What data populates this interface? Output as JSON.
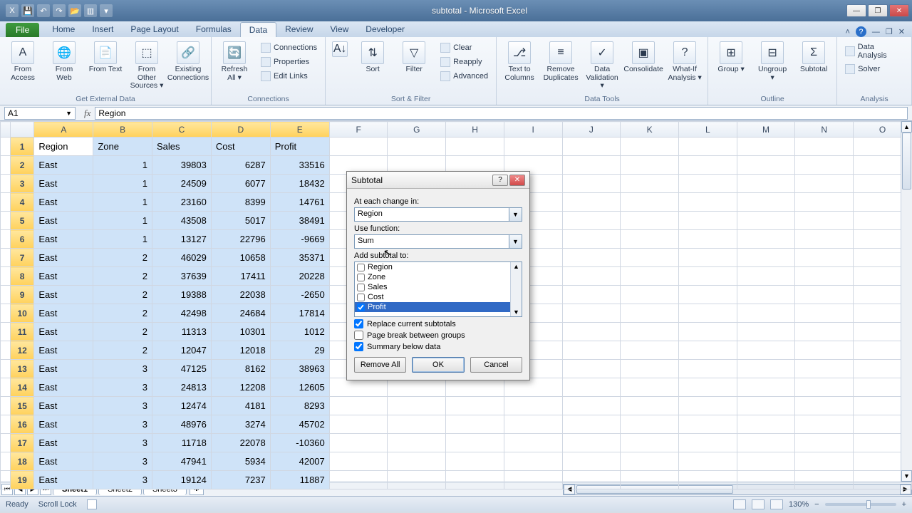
{
  "window": {
    "title": "subtotal - Microsoft Excel"
  },
  "tabs": {
    "file": "File",
    "list": [
      "Home",
      "Insert",
      "Page Layout",
      "Formulas",
      "Data",
      "Review",
      "View",
      "Developer"
    ],
    "active": "Data"
  },
  "ribbon": {
    "external": {
      "label": "Get External Data",
      "btns": [
        {
          "lbl": "From Access",
          "ico": "A"
        },
        {
          "lbl": "From Web",
          "ico": "🌐"
        },
        {
          "lbl": "From Text",
          "ico": "📄"
        },
        {
          "lbl": "From Other Sources ▾",
          "ico": "⬚"
        },
        {
          "lbl": "Existing Connections",
          "ico": "🔗"
        }
      ]
    },
    "connections": {
      "label": "Connections",
      "refresh": "Refresh All ▾",
      "items": [
        "Connections",
        "Properties",
        "Edit Links"
      ]
    },
    "sort": {
      "label": "Sort & Filter",
      "btns": [
        {
          "lbl": "Sort",
          "ico": "⇅"
        },
        {
          "lbl": "Filter",
          "ico": "▽"
        }
      ],
      "side": [
        "Clear",
        "Reapply",
        "Advanced"
      ]
    },
    "datatools": {
      "label": "Data Tools",
      "btns": [
        {
          "lbl": "Text to Columns",
          "ico": "⎇"
        },
        {
          "lbl": "Remove Duplicates",
          "ico": "≡"
        },
        {
          "lbl": "Data Validation ▾",
          "ico": "✓"
        },
        {
          "lbl": "Consolidate",
          "ico": "▣"
        },
        {
          "lbl": "What-If Analysis ▾",
          "ico": "?"
        }
      ]
    },
    "outline": {
      "label": "Outline",
      "btns": [
        {
          "lbl": "Group ▾",
          "ico": "⊞"
        },
        {
          "lbl": "Ungroup ▾",
          "ico": "⊟"
        },
        {
          "lbl": "Subtotal",
          "ico": "Σ"
        }
      ]
    },
    "analysis": {
      "label": "Analysis",
      "items": [
        "Data Analysis",
        "Solver"
      ]
    }
  },
  "namebox": "A1",
  "formula": "Region",
  "columns": [
    "A",
    "B",
    "C",
    "D",
    "E",
    "F",
    "G",
    "H",
    "I",
    "J",
    "K",
    "L",
    "M",
    "N",
    "O"
  ],
  "headers": [
    "Region",
    "Zone",
    "Sales",
    "Cost",
    "Profit"
  ],
  "rows": [
    [
      "East",
      1,
      39803,
      6287,
      33516
    ],
    [
      "East",
      1,
      24509,
      6077,
      18432
    ],
    [
      "East",
      1,
      23160,
      8399,
      14761
    ],
    [
      "East",
      1,
      43508,
      5017,
      38491
    ],
    [
      "East",
      1,
      13127,
      22796,
      -9669
    ],
    [
      "East",
      2,
      46029,
      10658,
      35371
    ],
    [
      "East",
      2,
      37639,
      17411,
      20228
    ],
    [
      "East",
      2,
      19388,
      22038,
      -2650
    ],
    [
      "East",
      2,
      42498,
      24684,
      17814
    ],
    [
      "East",
      2,
      11313,
      10301,
      1012
    ],
    [
      "East",
      2,
      12047,
      12018,
      29
    ],
    [
      "East",
      3,
      47125,
      8162,
      38963
    ],
    [
      "East",
      3,
      24813,
      12208,
      12605
    ],
    [
      "East",
      3,
      12474,
      4181,
      8293
    ],
    [
      "East",
      3,
      48976,
      3274,
      45702
    ],
    [
      "East",
      3,
      11718,
      22078,
      -10360
    ],
    [
      "East",
      3,
      47941,
      5934,
      42007
    ],
    [
      "East",
      3,
      19124,
      7237,
      11887
    ]
  ],
  "sheets": [
    "Sheet1",
    "Sheet2",
    "Sheet3"
  ],
  "status": {
    "ready": "Ready",
    "scroll": "Scroll Lock",
    "zoom": "130%"
  },
  "dialog": {
    "title": "Subtotal",
    "l1": "At each change in:",
    "combo1": "Region",
    "l2": "Use function:",
    "combo2": "Sum",
    "l3": "Add subtotal to:",
    "opts": [
      {
        "label": "Region",
        "checked": false,
        "hl": false
      },
      {
        "label": "Zone",
        "checked": false,
        "hl": false
      },
      {
        "label": "Sales",
        "checked": false,
        "hl": false
      },
      {
        "label": "Cost",
        "checked": false,
        "hl": false
      },
      {
        "label": "Profit",
        "checked": true,
        "hl": true
      }
    ],
    "chk1": {
      "label": "Replace current subtotals",
      "checked": true
    },
    "chk2": {
      "label": "Page break between groups",
      "checked": false
    },
    "chk3": {
      "label": "Summary below data",
      "checked": true
    },
    "btns": {
      "remove": "Remove All",
      "ok": "OK",
      "cancel": "Cancel"
    }
  }
}
